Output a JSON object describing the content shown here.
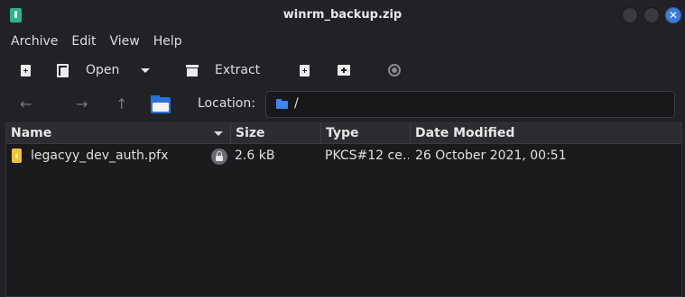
{
  "window": {
    "title": "winrm_backup.zip",
    "close_glyph": "✕"
  },
  "menu": [
    "Archive",
    "Edit",
    "View",
    "Help"
  ],
  "toolbar": {
    "open_label": "Open",
    "extract_label": "Extract"
  },
  "location": {
    "label": "Location:",
    "value": "/"
  },
  "nav": {
    "back_glyph": "←",
    "forward_glyph": "→",
    "up_glyph": "↑"
  },
  "columns": {
    "name": "Name",
    "size": "Size",
    "type": "Type",
    "date": "Date Modified"
  },
  "files": [
    {
      "name": "legacyy_dev_auth.pfx",
      "size": "2.6 kB",
      "type": "PKCS#12 ce…",
      "date": "26 October 2021, 00:51",
      "encrypted": true
    }
  ],
  "colors": {
    "background": "#222226",
    "accent": "#3d7bd8",
    "folder": "#2a73d8",
    "file_icon": "#f0c33a"
  }
}
